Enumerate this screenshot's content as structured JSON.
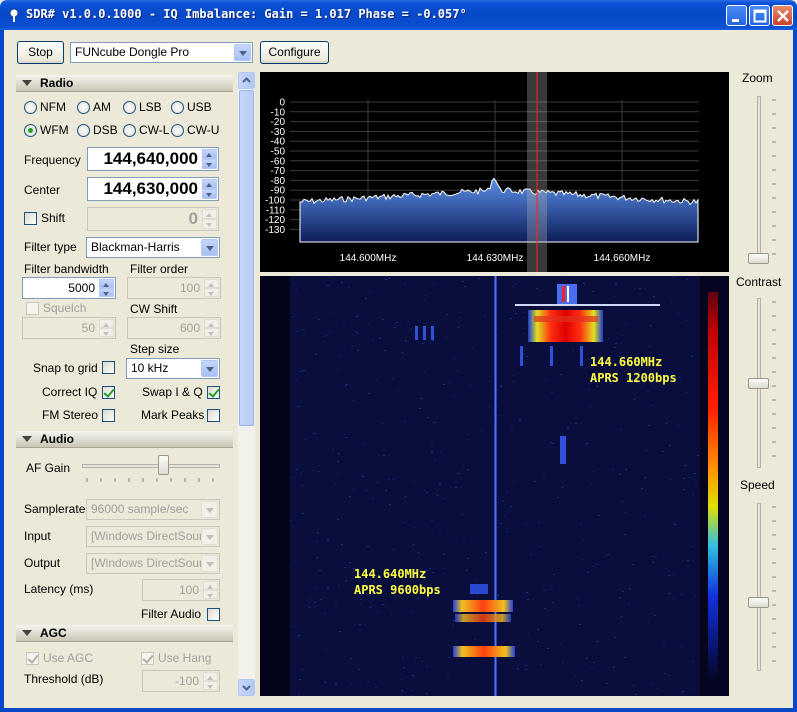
{
  "window": {
    "title": "SDR# v1.0.0.1000 - IQ Imbalance: Gain = 1.017 Phase = -0.057°"
  },
  "toolbar": {
    "stop_label": "Stop",
    "device_value": "FUNcube Dongle Pro",
    "configure_label": "Configure"
  },
  "radio": {
    "header": "Radio",
    "modes": [
      "NFM",
      "AM",
      "LSB",
      "USB",
      "WFM",
      "DSB",
      "CW-L",
      "CW-U"
    ],
    "selected_mode": "WFM",
    "frequency_label": "Frequency",
    "frequency_value": "144,640,000",
    "center_label": "Center",
    "center_value": "144,630,000",
    "shift_label": "Shift",
    "shift_value": "0",
    "filter_type_label": "Filter type",
    "filter_type_value": "Blackman-Harris",
    "filter_bandwidth_label": "Filter bandwidth",
    "filter_bandwidth_value": "5000",
    "filter_order_label": "Filter order",
    "filter_order_value": "100",
    "squelch_label": "Squelch",
    "squelch_value": "50",
    "cw_shift_label": "CW Shift",
    "cw_shift_value": "600",
    "step_size_label": "Step size",
    "step_size_value": "10 kHz",
    "snap_label": "Snap to grid",
    "correct_iq_label": "Correct IQ",
    "swap_iq_label": "Swap I & Q",
    "fm_stereo_label": "FM Stereo",
    "mark_peaks_label": "Mark Peaks"
  },
  "audio": {
    "header": "Audio",
    "af_gain_label": "AF Gain",
    "af_gain_level": 0.6,
    "samplerate_label": "Samplerate",
    "samplerate_value": "96000 sample/sec",
    "input_label": "Input",
    "input_value": "[Windows DirectSound",
    "output_label": "Output",
    "output_value": "[Windows DirectSound",
    "latency_label": "Latency (ms)",
    "latency_value": "100",
    "filter_audio_label": "Filter Audio"
  },
  "agc": {
    "header": "AGC",
    "use_agc_label": "Use AGC",
    "use_hang_label": "Use Hang",
    "threshold_label": "Threshold (dB)",
    "threshold_value": "-100"
  },
  "spectrum": {
    "db_ticks": [
      "0",
      "-10",
      "-20",
      "-30",
      "-40",
      "-50",
      "-60",
      "-70",
      "-80",
      "-90",
      "-100",
      "-110",
      "-120",
      "-130"
    ],
    "freq_ticks": [
      "144.600MHz",
      "144.630MHz",
      "144.660MHz"
    ]
  },
  "waterfall": {
    "annotation_1200_freq": "144.660MHz",
    "annotation_1200_mode": "APRS 1200bps",
    "annotation_9600_freq": "144.640MHz",
    "annotation_9600_mode": "APRS 9600bps"
  },
  "right_panel": {
    "zoom_label": "Zoom",
    "contrast_label": "Contrast",
    "speed_label": "Speed",
    "zoom_level": 0.0,
    "contrast_level": 0.5,
    "speed_level": 0.4
  },
  "colors": {
    "title_bar": "#0848c8",
    "spectrum_fill": "#3a6cc8",
    "annotation_text": "#ffff40",
    "tuned_marker": "#ff2020"
  }
}
